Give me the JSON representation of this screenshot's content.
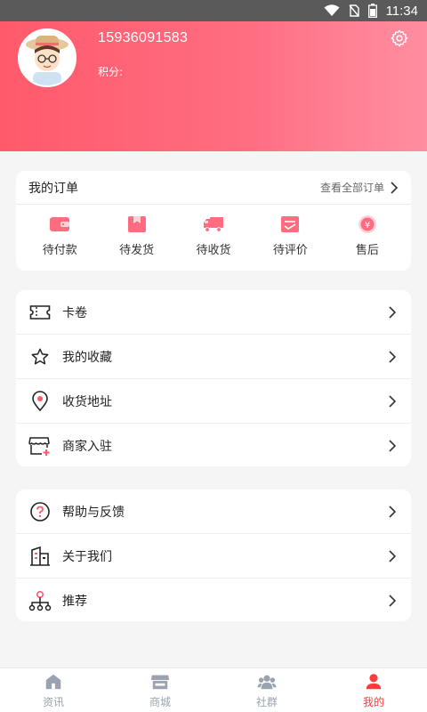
{
  "status_bar": {
    "time": "11:34"
  },
  "profile": {
    "phone": "15936091583",
    "points_label": "积分:"
  },
  "orders": {
    "title": "我的订单",
    "view_all": "查看全部订单",
    "items": [
      {
        "label": "待付款",
        "icon": "wallet-icon"
      },
      {
        "label": "待发货",
        "icon": "package-icon"
      },
      {
        "label": "待收货",
        "icon": "truck-icon"
      },
      {
        "label": "待评价",
        "icon": "review-icon"
      },
      {
        "label": "售后",
        "icon": "after-sale-icon"
      }
    ]
  },
  "menu1": [
    {
      "label": "卡卷",
      "icon": "ticket-icon"
    },
    {
      "label": "我的收藏",
      "icon": "star-icon"
    },
    {
      "label": "收货地址",
      "icon": "location-icon"
    },
    {
      "label": "商家入驻",
      "icon": "store-icon"
    }
  ],
  "menu2": [
    {
      "label": "帮助与反馈",
      "icon": "help-icon"
    },
    {
      "label": "关于我们",
      "icon": "building-icon"
    },
    {
      "label": "推荐",
      "icon": "share-network-icon"
    }
  ],
  "tabbar": [
    {
      "label": "资讯",
      "icon": "home-icon",
      "active": false
    },
    {
      "label": "商城",
      "icon": "shop-icon",
      "active": false
    },
    {
      "label": "社群",
      "icon": "community-icon",
      "active": false
    },
    {
      "label": "我的",
      "icon": "person-icon",
      "active": true
    }
  ],
  "colors": {
    "header_start": "#ff5a6c",
    "header_end": "#ff8ea0",
    "accent": "#ff3b3b",
    "icon_pink": "#ff6b7f"
  }
}
